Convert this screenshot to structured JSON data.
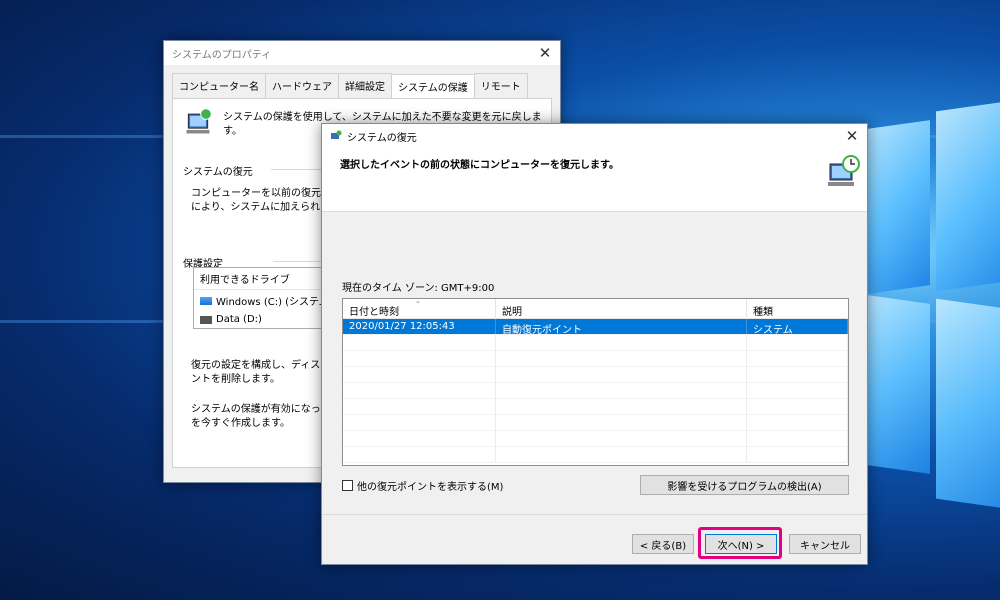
{
  "sysprop": {
    "title": "システムのプロパティ",
    "tabs": [
      "コンピューター名",
      "ハードウェア",
      "詳細設定",
      "システムの保護",
      "リモート"
    ],
    "intro": "システムの保護を使用して、システムに加えた不要な変更を元に戻します。",
    "restore_group": "システムの復元",
    "restore_text_1": "コンピューターを以前の復元ポイント",
    "restore_text_2": "により、システムに加えられた変更を",
    "protect_group": "保護設定",
    "drives_header": "利用できるドライブ",
    "drives": [
      "Windows (C:) (システム)",
      "Data (D:)"
    ],
    "config_text_1": "復元の設定を構成し、ディスク領",
    "config_text_2": "ントを削除します。",
    "create_text_1": "システムの保護が有効になってい",
    "create_text_2": "を今すぐ作成します。"
  },
  "restore": {
    "title": "システムの復元",
    "heading": "選択したイベントの前の状態にコンピューターを復元します。",
    "timezone": "現在のタイム ゾーン: GMT+9:00",
    "columns": [
      "日付と時刻",
      "説明",
      "種類"
    ],
    "rows": [
      {
        "date": "2020/01/27 12:05:43",
        "desc": "自動復元ポイント",
        "type": "システム"
      }
    ],
    "show_more": "他の復元ポイントを表示する(M)",
    "scan_button": "影響を受けるプログラムの検出(A)",
    "back_button": "< 戻る(B)",
    "next_button": "次へ(N) >",
    "cancel_button": "キャンセル"
  },
  "colors": {
    "accent": "#0078d7",
    "highlight": "#e4007f"
  }
}
